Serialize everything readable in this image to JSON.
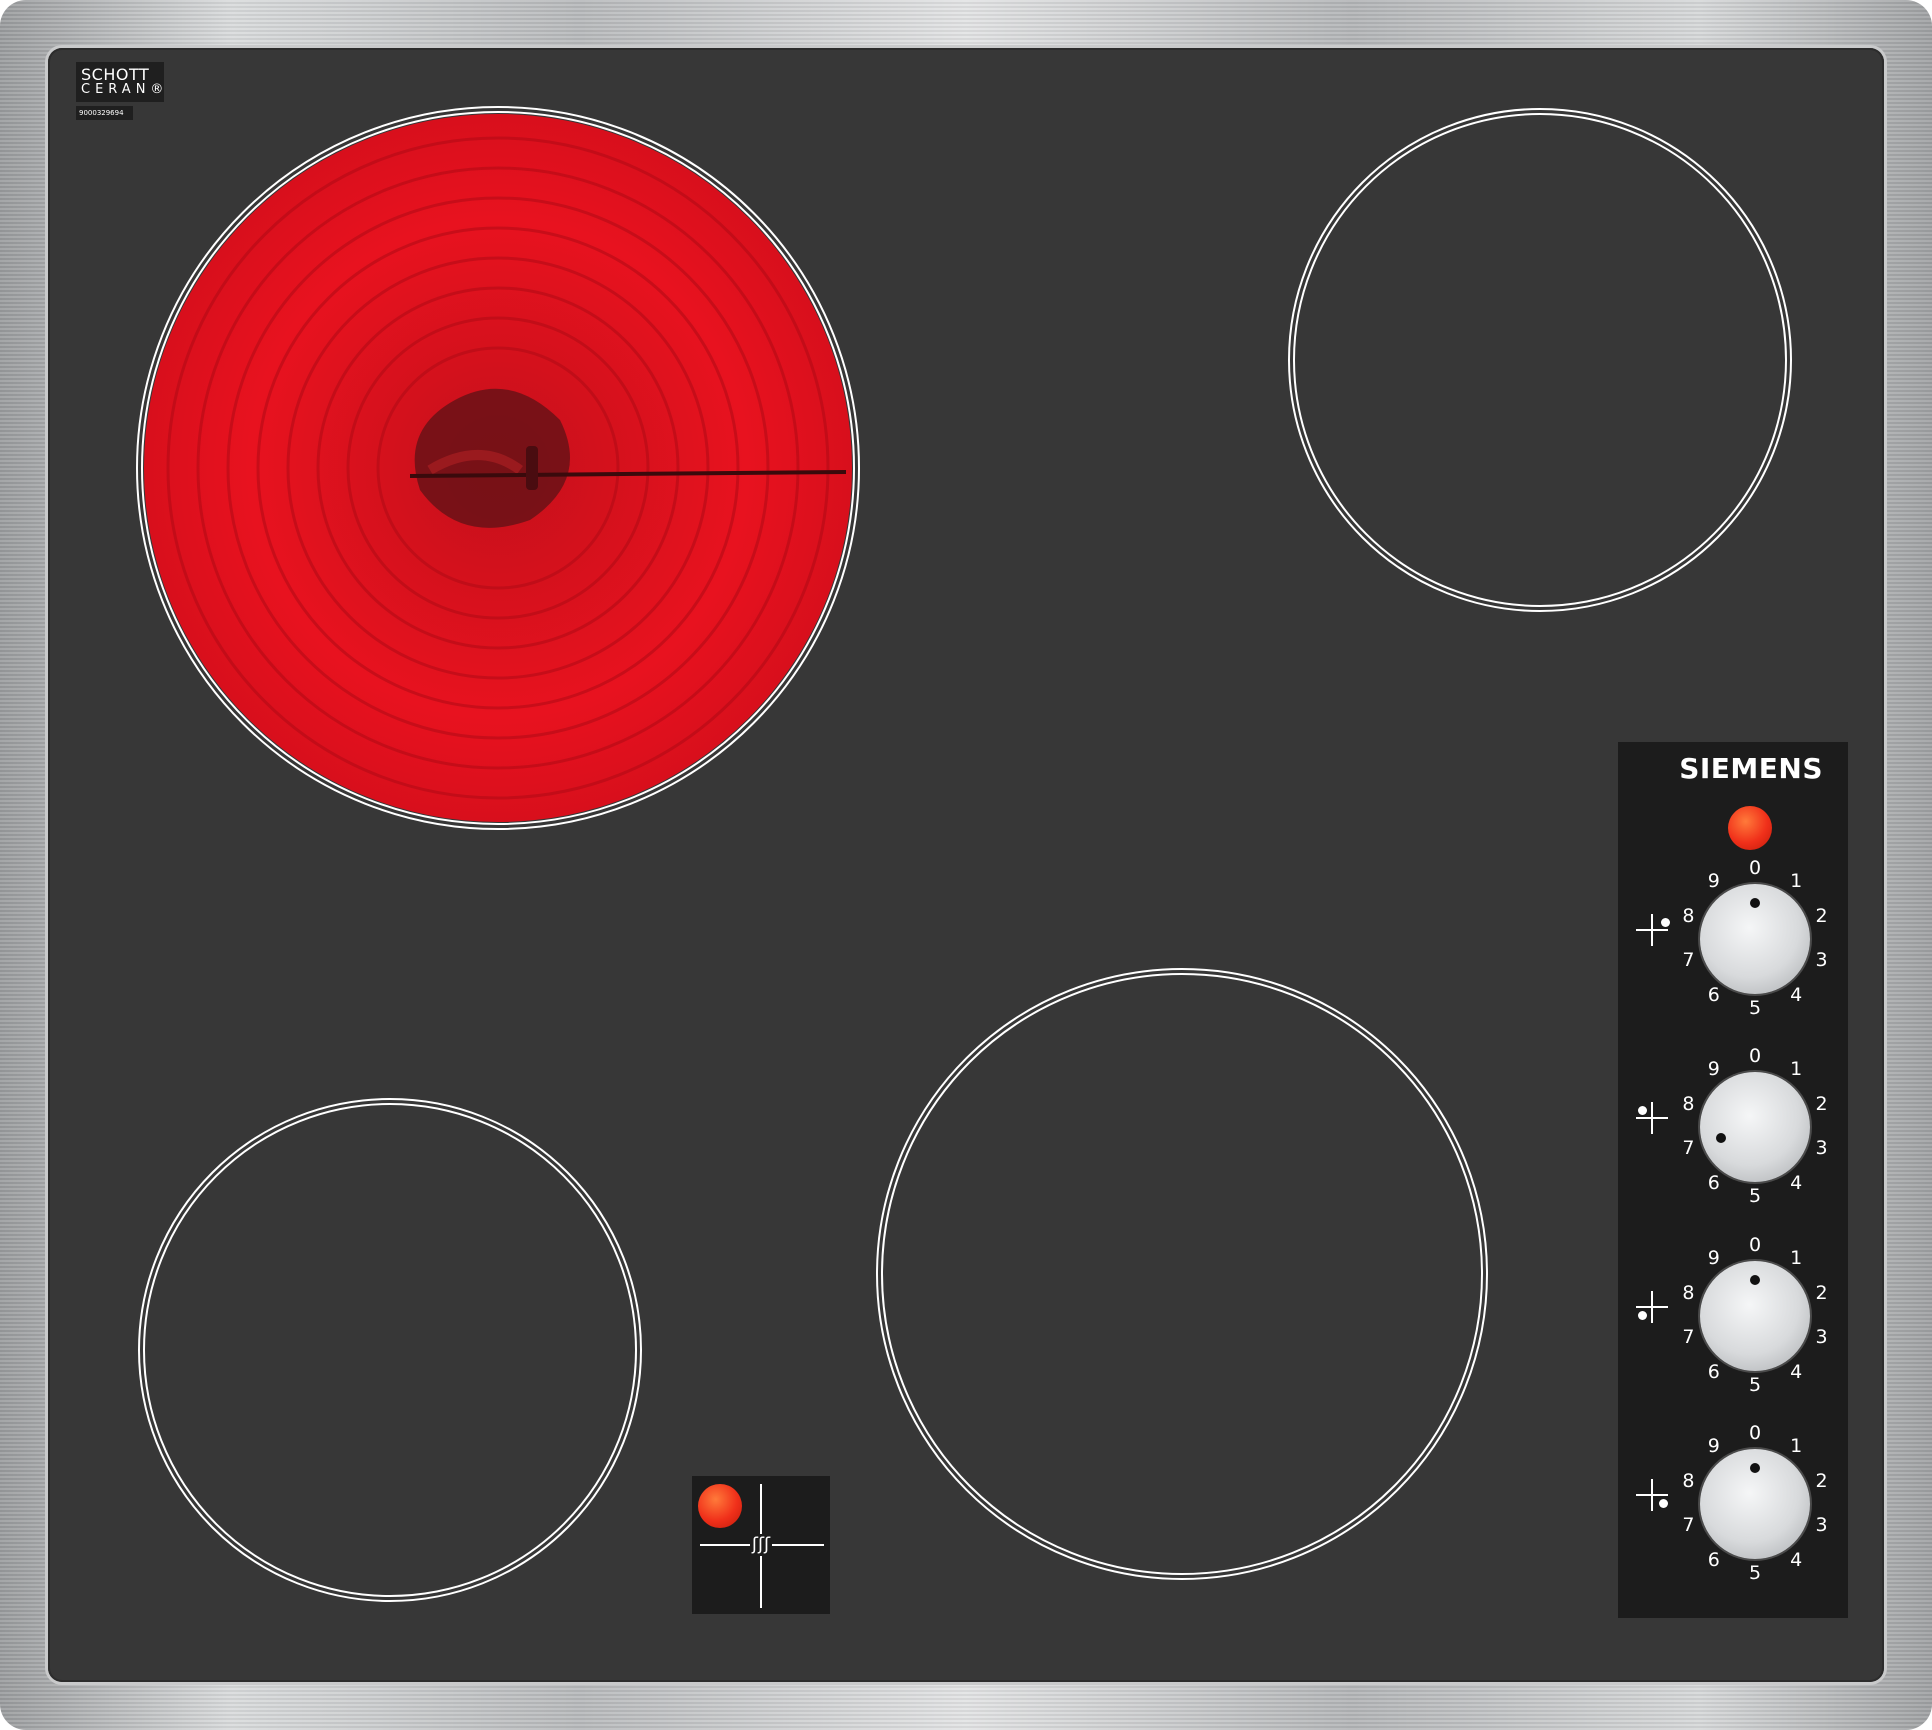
{
  "brand": "SIEMENS",
  "glass_logo": {
    "line1": "SCHOTT",
    "line2": "CERAN®",
    "serial": "9000329694"
  },
  "knob_numbers": [
    "0",
    "1",
    "2",
    "3",
    "4",
    "5",
    "6",
    "7",
    "8",
    "9"
  ],
  "knobs": [
    {
      "zone": "rear-right",
      "setting": 0
    },
    {
      "zone": "rear-left",
      "setting": 7
    },
    {
      "zone": "front-left",
      "setting": 0
    },
    {
      "zone": "front-right",
      "setting": 0
    }
  ],
  "zones": [
    {
      "id": "rear-left",
      "state": "glowing"
    },
    {
      "id": "rear-right",
      "state": "off"
    },
    {
      "id": "front-left",
      "state": "off"
    },
    {
      "id": "front-right",
      "state": "off"
    }
  ],
  "residual_heat_symbol": "ʃʃʃ",
  "colors": {
    "glass": "#373737",
    "heat_red": "#e8121f",
    "panel": "#1c1c1c",
    "indicator": "#f0301a"
  }
}
